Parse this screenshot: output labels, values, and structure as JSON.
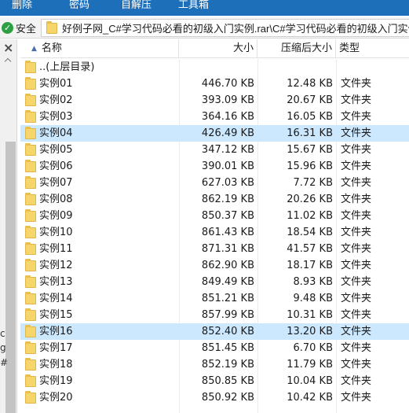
{
  "toolbar": {
    "delete": "删除",
    "password": "密码",
    "sfx": "自解压",
    "tools": "工具箱"
  },
  "address": {
    "secure_label": "安全",
    "path": "好例子网_C#学习代码必看的初级入门实例.rar\\C#学习代码必看的初级入门实例"
  },
  "left_pane": {
    "fragments": [
      "c",
      "g",
      "#"
    ]
  },
  "columns": {
    "name": "名称",
    "size": "大小",
    "compressed": "压缩后大小",
    "type": "类型"
  },
  "parent_row": {
    "name": "..(上层目录)"
  },
  "rows": [
    {
      "name": "实例01",
      "size": "446.70 KB",
      "compressed": "12.48 KB",
      "type": "文件夹"
    },
    {
      "name": "实例02",
      "size": "393.09 KB",
      "compressed": "20.67 KB",
      "type": "文件夹"
    },
    {
      "name": "实例03",
      "size": "364.16 KB",
      "compressed": "16.05 KB",
      "type": "文件夹"
    },
    {
      "name": "实例04",
      "size": "426.49 KB",
      "compressed": "16.31 KB",
      "type": "文件夹"
    },
    {
      "name": "实例05",
      "size": "347.12 KB",
      "compressed": "15.67 KB",
      "type": "文件夹"
    },
    {
      "name": "实例06",
      "size": "390.01 KB",
      "compressed": "15.96 KB",
      "type": "文件夹"
    },
    {
      "name": "实例07",
      "size": "627.03 KB",
      "compressed": "7.72 KB",
      "type": "文件夹"
    },
    {
      "name": "实例08",
      "size": "862.19 KB",
      "compressed": "20.26 KB",
      "type": "文件夹"
    },
    {
      "name": "实例09",
      "size": "850.37 KB",
      "compressed": "11.02 KB",
      "type": "文件夹"
    },
    {
      "name": "实例10",
      "size": "861.43 KB",
      "compressed": "18.54 KB",
      "type": "文件夹"
    },
    {
      "name": "实例11",
      "size": "871.31 KB",
      "compressed": "41.57 KB",
      "type": "文件夹"
    },
    {
      "name": "实例12",
      "size": "862.90 KB",
      "compressed": "18.17 KB",
      "type": "文件夹"
    },
    {
      "name": "实例13",
      "size": "849.49 KB",
      "compressed": "8.93 KB",
      "type": "文件夹"
    },
    {
      "name": "实例14",
      "size": "851.21 KB",
      "compressed": "9.48 KB",
      "type": "文件夹"
    },
    {
      "name": "实例15",
      "size": "857.99 KB",
      "compressed": "10.31 KB",
      "type": "文件夹"
    },
    {
      "name": "实例16",
      "size": "852.40 KB",
      "compressed": "13.20 KB",
      "type": "文件夹"
    },
    {
      "name": "实例17",
      "size": "851.45 KB",
      "compressed": "6.70 KB",
      "type": "文件夹"
    },
    {
      "name": "实例18",
      "size": "852.19 KB",
      "compressed": "11.79 KB",
      "type": "文件夹"
    },
    {
      "name": "实例19",
      "size": "850.85 KB",
      "compressed": "10.04 KB",
      "type": "文件夹"
    },
    {
      "name": "实例20",
      "size": "850.92 KB",
      "compressed": "10.42 KB",
      "type": "文件夹"
    }
  ],
  "selected_rows": [
    "实例04",
    "实例16"
  ],
  "colors": {
    "toolbar_bg": "#1e6fba",
    "selection_bg": "#cce8ff",
    "folder_yellow": "#f6d66b",
    "secure_green": "#2ea043"
  },
  "icons": {
    "secure": "check-circle-icon",
    "folder": "folder-icon",
    "close": "close-icon",
    "sort": "sort-up-icon"
  }
}
